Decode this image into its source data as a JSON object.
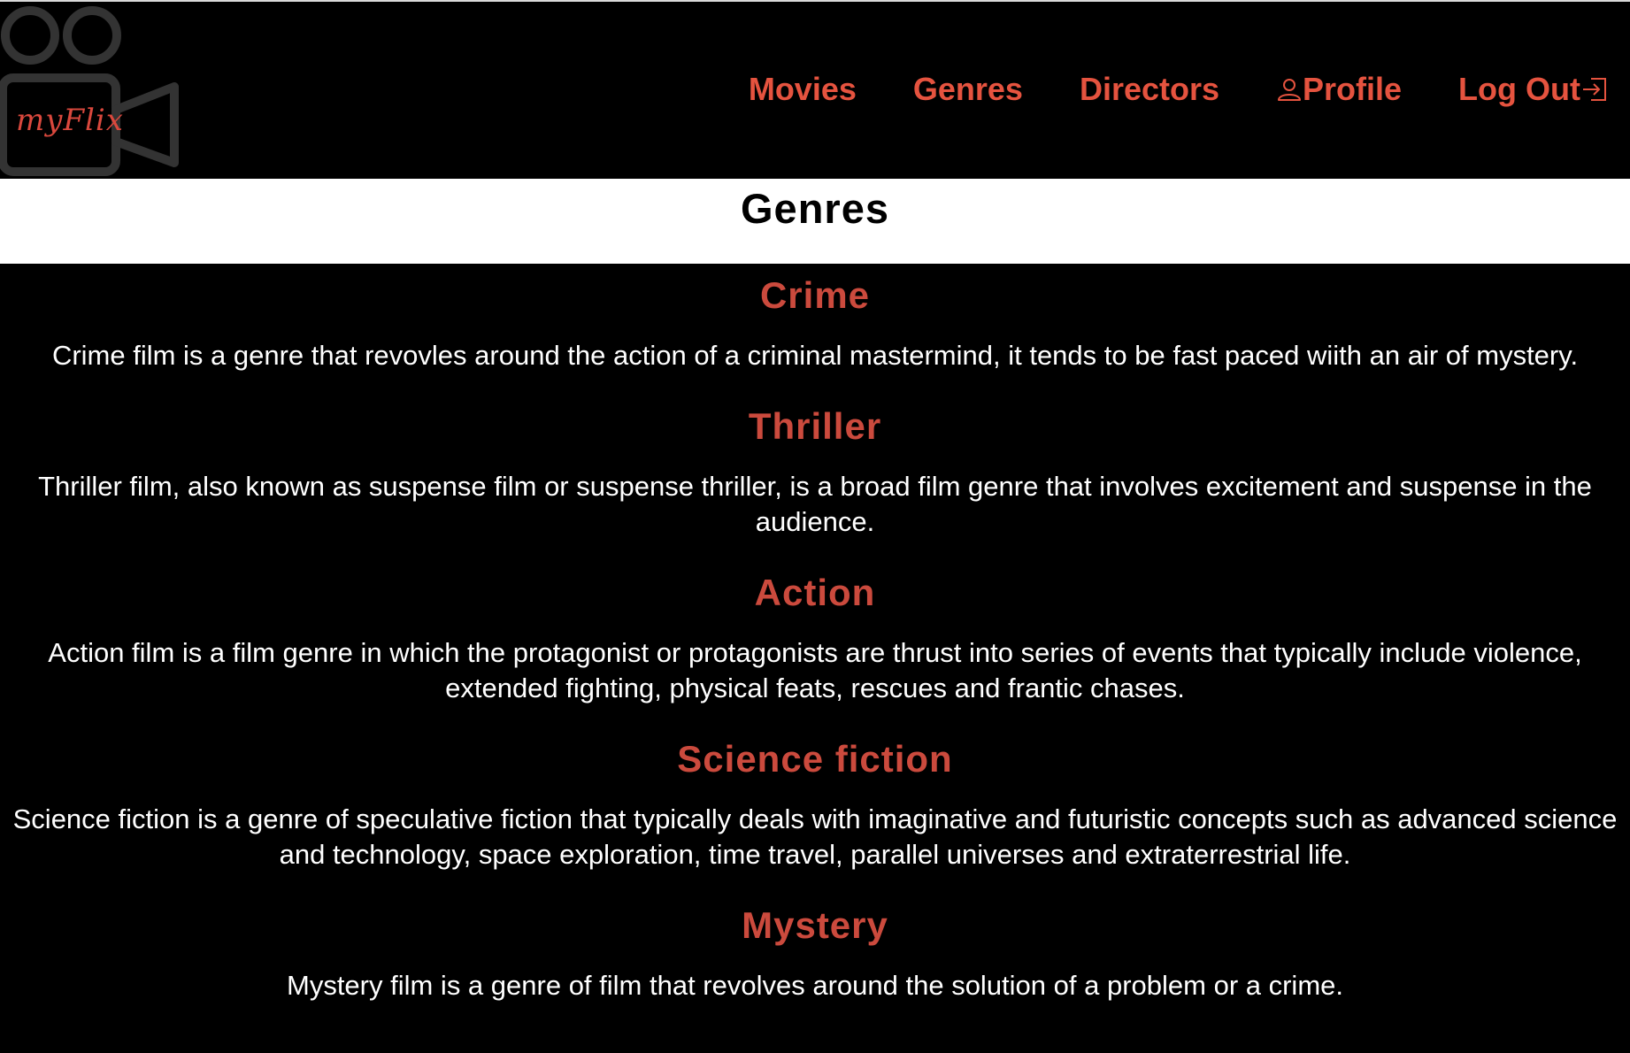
{
  "app": {
    "logo_text": "myFlix"
  },
  "nav": {
    "movies": "Movies",
    "genres": "Genres",
    "directors": "Directors",
    "profile": "Profile",
    "logout": "Log Out"
  },
  "page": {
    "title": "Genres"
  },
  "genres": [
    {
      "name": "Crime",
      "description": "Crime film is a genre that revovles around the action of a criminal mastermind, it tends to be fast paced wiith an air of mystery."
    },
    {
      "name": "Thriller",
      "description": "Thriller film, also known as suspense film or suspense thriller, is a broad film genre that involves excitement and suspense in the audience."
    },
    {
      "name": "Action",
      "description": "Action film is a film genre in which the protagonist or protagonists are thrust into series of events that typically include violence, extended fighting, physical feats, rescues and frantic chases."
    },
    {
      "name": "Science fiction",
      "description": "Science fiction is a genre of speculative fiction that typically deals with imaginative and futuristic concepts such as advanced science and technology, space exploration, time travel, parallel universes and extraterrestrial life."
    },
    {
      "name": "Mystery",
      "description": "Mystery film is a genre of film that revolves around the solution of a problem or a crime."
    }
  ],
  "colors": {
    "nav_link": "#e5533f",
    "genre_name": "#cb4a3d",
    "background": "#000000",
    "header_background": "#ffffff",
    "logo_outline": "#333333"
  },
  "icons": {
    "logo": "film-camera-icon",
    "profile": "user-icon",
    "logout": "logout-icon"
  }
}
